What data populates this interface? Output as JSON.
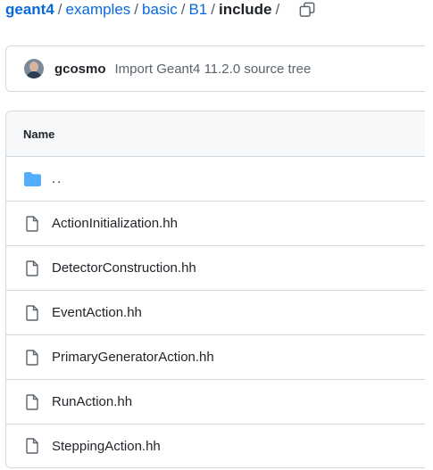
{
  "breadcrumb": {
    "repo": "geant4",
    "path": [
      "examples",
      "basic",
      "B1"
    ],
    "current": "include",
    "separator": "/"
  },
  "commit": {
    "author": "gcosmo",
    "message": "Import Geant4 11.2.0 source tree"
  },
  "table": {
    "header": "Name",
    "parent": "..",
    "files": [
      "ActionInitialization.hh",
      "DetectorConstruction.hh",
      "EventAction.hh",
      "PrimaryGeneratorAction.hh",
      "RunAction.hh",
      "SteppingAction.hh"
    ]
  },
  "colors": {
    "link": "#0969da",
    "folder": "#54aeff",
    "border": "#d1d9e0",
    "header_bg": "#f6f8fa"
  },
  "icons": {
    "copy": "copy-icon",
    "folder": "folder-icon",
    "file": "file-icon"
  }
}
